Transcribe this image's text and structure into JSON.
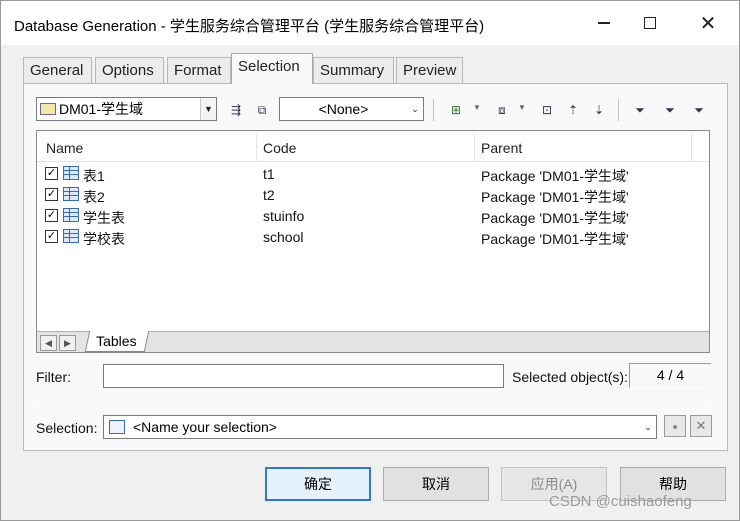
{
  "window": {
    "title": "Database Generation - 学生服务综合管理平台 (学生服务综合管理平台)",
    "minimize_label": "—",
    "maximize_label": "□",
    "close_label": "✕"
  },
  "tabs": [
    {
      "label": "General"
    },
    {
      "label": "Options"
    },
    {
      "label": "Format"
    },
    {
      "label": "Selection",
      "active": true
    },
    {
      "label": "Summary"
    },
    {
      "label": "Preview"
    }
  ],
  "toolbar": {
    "package_value": "DM01-学生域",
    "filter_combo_value": "<None>"
  },
  "list": {
    "headers": [
      "Name",
      "Code",
      "Parent"
    ],
    "rows": [
      {
        "checked": true,
        "name": "表1",
        "code": "t1",
        "parent": "Package 'DM01-学生域'"
      },
      {
        "checked": true,
        "name": "表2",
        "code": "t2",
        "parent": "Package 'DM01-学生域'"
      },
      {
        "checked": true,
        "name": "学生表",
        "code": "stuinfo",
        "parent": "Package 'DM01-学生域'"
      },
      {
        "checked": true,
        "name": "学校表",
        "code": "school",
        "parent": "Package 'DM01-学生域'"
      }
    ],
    "sheet_tab": "Tables"
  },
  "filter": {
    "label": "Filter:",
    "value": "",
    "selected_label": "Selected object(s):",
    "selected_count": "4 / 4"
  },
  "selection": {
    "label": "Selection:",
    "value": "<Name your selection>"
  },
  "buttons": {
    "ok": "确定",
    "cancel": "取消",
    "apply": "应用(A)",
    "help": "帮助"
  },
  "watermark": "CSDN @cuishaofeng"
}
